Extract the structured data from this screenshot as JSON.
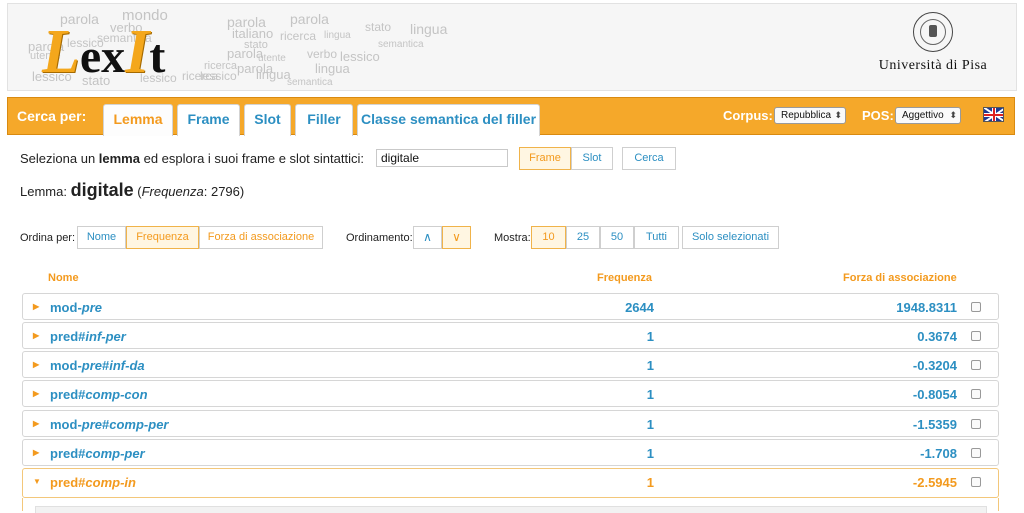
{
  "header": {
    "logo_big_1": "L",
    "logo_small_1": "ex",
    "logo_big_2": "I",
    "logo_small_2": "t",
    "word_cloud": [
      "parola",
      "mondo",
      "parola",
      "parola",
      "verbo",
      "semantica",
      "stato",
      "lingua",
      "parola",
      "lessico",
      "italiano",
      "ricerca",
      "lingua",
      "semantica",
      "utente",
      "verbo",
      "lessico",
      "parola",
      "ricerca",
      "lingua",
      "lessico",
      "stato",
      "lessico",
      "ricerca",
      "lessico",
      "semantica",
      "parola",
      "utente",
      "stato",
      "lingua"
    ],
    "university": "Università di Pisa"
  },
  "nav": {
    "label": "Cerca per:",
    "tabs": [
      {
        "label": "Lemma",
        "active": true
      },
      {
        "label": "Frame",
        "active": false
      },
      {
        "label": "Slot",
        "active": false
      },
      {
        "label": "Filler",
        "active": false
      },
      {
        "label": "Classe semantica del filler",
        "active": false
      }
    ],
    "corpus_label": "Corpus:",
    "corpus_value": "Repubblica",
    "pos_label": "POS:",
    "pos_value": "Aggettivo",
    "flag": "uk-flag-icon"
  },
  "search": {
    "prompt_pre": "Seleziona un ",
    "prompt_bold": "lemma",
    "prompt_post": " ed esplora i suoi frame e slot sintattici:",
    "value": "digitale",
    "btn_frame": "Frame",
    "btn_slot": "Slot",
    "btn_cerca": "Cerca"
  },
  "lemma": {
    "label": "Lemma:",
    "word": "digitale",
    "freq_label": "Frequenza",
    "freq_value": ": 2796)"
  },
  "controls": {
    "order_by_label": "Ordina per:",
    "order_by": [
      "Nome",
      "Frequenza",
      "Forza di associazione"
    ],
    "order_by_active": "Frequenza",
    "ordering_label": "Ordinamento:",
    "asc": "∧",
    "desc": "∨",
    "show_label": "Mostra:",
    "show": [
      "10",
      "25",
      "50",
      "Tutti"
    ],
    "show_active": "10",
    "only_selected": "Solo selezionati"
  },
  "table": {
    "headers": [
      "Nome",
      "Frequenza",
      "Forza di associazione"
    ],
    "rows": [
      {
        "name_a": "mod-",
        "name_b": "pre",
        "name_c": "",
        "name_d": "",
        "freq": "2644",
        "assoc": "1948.8311",
        "open": false
      },
      {
        "name_a": "pred#",
        "name_b": "inf-per",
        "name_c": "",
        "name_d": "",
        "freq": "1",
        "assoc": "0.3674",
        "open": false
      },
      {
        "name_a": "mod-",
        "name_b": "pre",
        "name_c": "#",
        "name_d": "inf-da",
        "freq": "1",
        "assoc": "-0.3204",
        "open": false
      },
      {
        "name_a": "pred#",
        "name_b": "comp-con",
        "name_c": "",
        "name_d": "",
        "freq": "1",
        "assoc": "-0.8054",
        "open": false
      },
      {
        "name_a": "mod-",
        "name_b": "pre",
        "name_c": "#",
        "name_d": "comp-per",
        "freq": "1",
        "assoc": "-1.5359",
        "open": false
      },
      {
        "name_a": "pred#",
        "name_b": "comp-per",
        "name_c": "",
        "name_d": "",
        "freq": "1",
        "assoc": "-1.708",
        "open": false
      },
      {
        "name_a": "pred#",
        "name_b": "comp-in",
        "name_c": "",
        "name_d": "",
        "freq": "1",
        "assoc": "-2.5945",
        "open": true
      }
    ]
  },
  "colors": {
    "accent": "#f5a82a",
    "link": "#2c8fc2",
    "active": "#f39a1e"
  }
}
